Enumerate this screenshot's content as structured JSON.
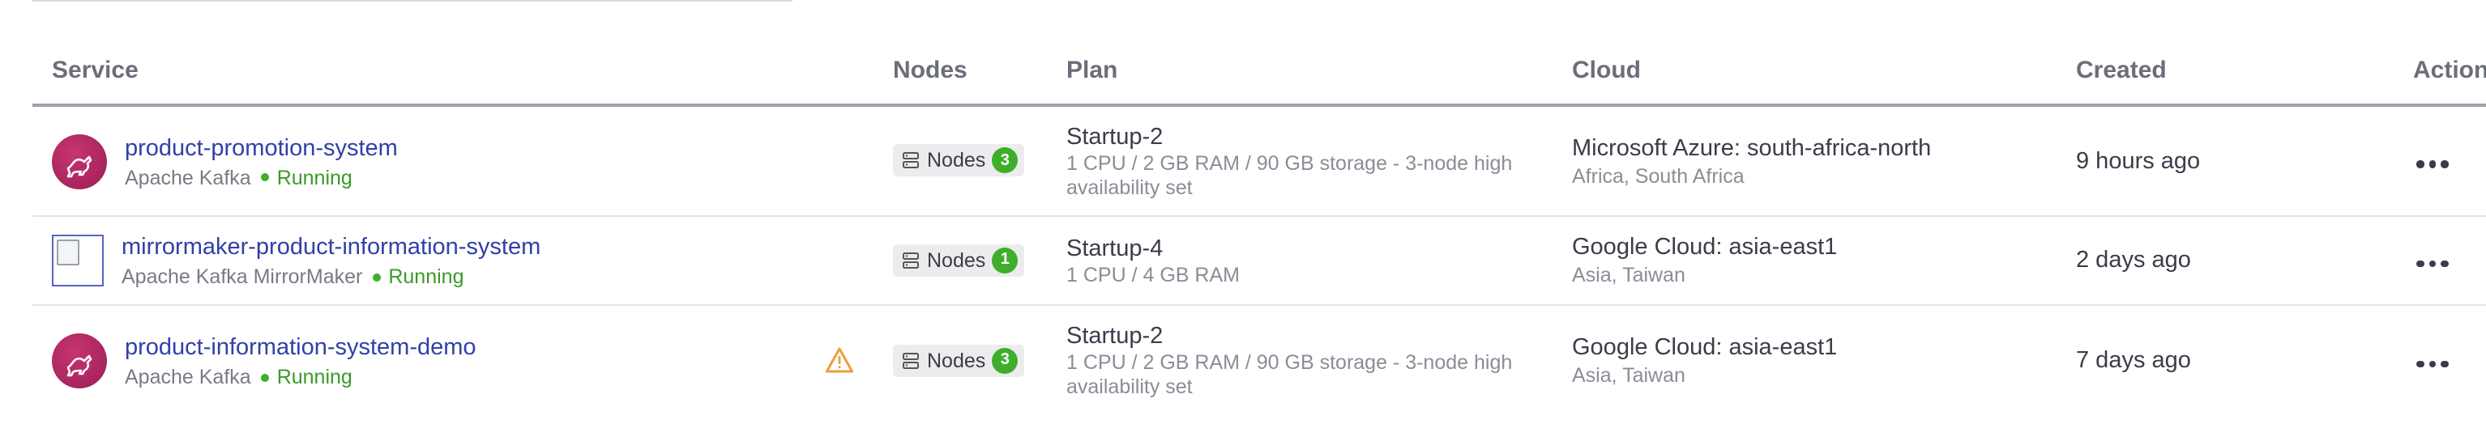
{
  "table": {
    "headers": {
      "service": "Service",
      "nodes": "Nodes",
      "plan": "Plan",
      "cloud": "Cloud",
      "created": "Created",
      "action": "Action"
    },
    "rows": [
      {
        "name": "product-promotion-system",
        "type": "Apache Kafka",
        "status": "Running",
        "icon": "kafka-icon",
        "nodes_label": "Nodes",
        "nodes_count": "3",
        "plan": "Startup-2",
        "plan_desc": "1 CPU / 2 GB RAM / 90 GB storage - 3-node high availability set",
        "cloud": "Microsoft Azure: south-africa-north",
        "region": "Africa, South Africa",
        "created": "9 hours ago",
        "warning": false
      },
      {
        "name": "mirrormaker-product-information-system",
        "type": "Apache Kafka MirrorMaker",
        "status": "Running",
        "icon": "broken-image-icon",
        "nodes_label": "Nodes",
        "nodes_count": "1",
        "plan": "Startup-4",
        "plan_desc": "1 CPU / 4 GB RAM",
        "cloud": "Google Cloud: asia-east1",
        "region": "Asia, Taiwan",
        "created": "2 days ago",
        "warning": false
      },
      {
        "name": "product-information-system-demo",
        "type": "Apache Kafka",
        "status": "Running",
        "icon": "kafka-icon",
        "nodes_label": "Nodes",
        "nodes_count": "3",
        "plan": "Startup-2",
        "plan_desc": "1 CPU / 2 GB RAM / 90 GB storage - 3-node high availability set",
        "cloud": "Google Cloud: asia-east1",
        "region": "Asia, Taiwan",
        "created": "7 days ago",
        "warning": true
      }
    ]
  },
  "colors": {
    "link": "#3140a8",
    "running": "#3a9a28",
    "badge_count": "#3fae2a",
    "warning": "#e8a13a",
    "kafka_avatar": "#b12a63"
  }
}
